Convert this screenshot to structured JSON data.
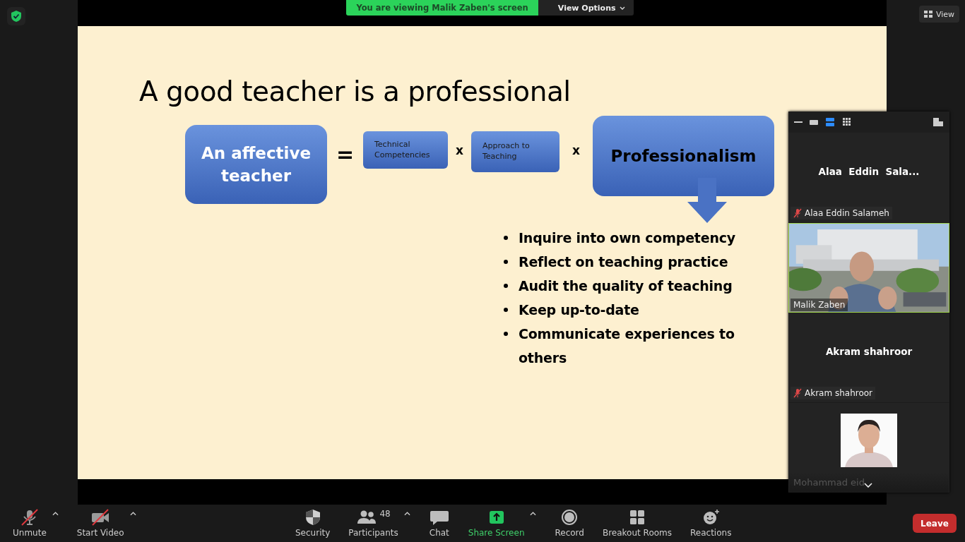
{
  "banner": {
    "text": "You are viewing Malik Zaben's screen",
    "options": "View Options"
  },
  "view_button": "View",
  "slide": {
    "title": "A good teacher is a professional",
    "equation": [
      {
        "kind": "big-box",
        "text": "An affective teacher"
      },
      {
        "kind": "operator",
        "text": "="
      },
      {
        "kind": "small-box",
        "text": "Technical Competencies"
      },
      {
        "kind": "operator",
        "text": "x"
      },
      {
        "kind": "small-box",
        "text": "Approach to Teaching"
      },
      {
        "kind": "operator",
        "text": "x"
      },
      {
        "kind": "big-box-arrow",
        "text": "Professionalism"
      }
    ],
    "bullets": [
      " Inquire into own competency",
      "Reflect on teaching practice",
      "Audit the quality of teaching",
      "Keep up-to-date",
      "Communicate experiences to others"
    ]
  },
  "view_modes": [
    {
      "selected": false
    },
    {
      "selected": false
    },
    {
      "selected": true
    },
    {
      "selected": false
    }
  ],
  "tiles": [
    {
      "kind": "name",
      "display_name": "Alaa  Eddin  Sala...",
      "label": "Alaa Eddin Salameh",
      "muted": true,
      "speaking": false
    },
    {
      "kind": "video",
      "label": "Malik Zaben",
      "muted": false,
      "speaking": true
    },
    {
      "kind": "name",
      "display_name": "Akram shahroor",
      "label": "Akram shahroor",
      "muted": true,
      "speaking": false
    },
    {
      "label": "Mohammad eid",
      "muted": false,
      "speaking": false
    }
  ],
  "toolbar": [
    {
      "kind": "mic",
      "label": "Unmute",
      "crossed": true,
      "caret": true
    },
    {
      "kind": "camera",
      "label": "Start Video",
      "crossed": true,
      "caret": true
    },
    {
      "kind": "security",
      "label": "Security",
      "crossed": false,
      "caret": false
    },
    {
      "kind": "participants",
      "label": "Participants",
      "count": "48",
      "crossed": false,
      "caret": true
    },
    {
      "kind": "chat",
      "label": "Chat",
      "crossed": false,
      "caret": false
    },
    {
      "kind": "share",
      "label": "Share Screen",
      "crossed": false,
      "caret": true
    },
    {
      "kind": "record",
      "label": "Record",
      "crossed": false,
      "caret": false
    },
    {
      "kind": "breakout",
      "label": "Breakout Rooms",
      "crossed": false,
      "caret": false
    },
    {
      "kind": "reactions",
      "label": "Reactions",
      "crossed": false,
      "caret": false
    }
  ],
  "leave_button": "Leave"
}
